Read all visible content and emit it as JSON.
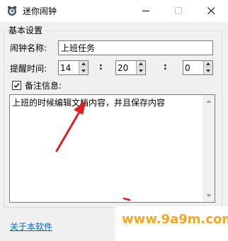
{
  "window": {
    "title": "迷你闹钟",
    "icon": "alarm-clock-icon",
    "controls": [
      "minimize-icon",
      "maximize-icon",
      "close-icon"
    ]
  },
  "settings": {
    "group_title": "基本设置",
    "name_label": "闹钟名称:",
    "name_value": "上班任务",
    "time_label": "提醒时间:",
    "hour": "14",
    "minute": "20",
    "second": "0",
    "separator": ":",
    "note_label": "备注信息:",
    "note_checked": true,
    "note_text": "上班的时候编辑文档内容，并且保存内容"
  },
  "footer": {
    "about_link": "关于本软件",
    "watermark": "www.9a9m.com"
  },
  "colors": {
    "annotation_arrow": "#e02020",
    "link": "#0066cc",
    "watermark": "#f5a623"
  }
}
